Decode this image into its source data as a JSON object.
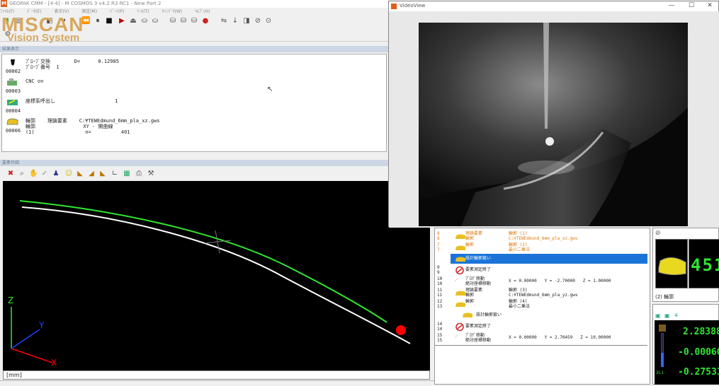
{
  "app": {
    "icon_letter": "M",
    "title": "GEOPAK CMM - [4-4] - M COSMOS 3 v4.2 R3 RC1 - New Part 2",
    "menu": [
      "ﾌｧｲﾙ(F)",
      "ﾃﾞｰﾀ(E)",
      "表示(V)",
      "測定(M)",
      "ﾊﾟｰﾄ(P)",
      "ﾂｰﾙ(T)",
      "ｳｨﾝﾄﾞｳ(W)",
      "ﾍﾙﾌﾟ(H)"
    ],
    "logo_line1": "MISCAN",
    "logo_line2": "Vision System",
    "accent": "#e35d1a"
  },
  "results": {
    "header": "結果表示",
    "rows": [
      {
        "num": "00002",
        "icon": "probe-icon",
        "text": "ﾌﾟﾛｰﾌﾞ交換        D=      0.12985\nﾌﾟﾛｰﾌﾞ番号  1"
      },
      {
        "num": "00003",
        "icon": "cnc-icon",
        "text": "CNC on"
      },
      {
        "num": "00004",
        "icon": "coordinate-icon",
        "text": "座標系呼出し                    1"
      },
      {
        "num": "00006",
        "icon": "contour-icon",
        "text": "輪郭    理論要素    C:¥TEWEdmund_6mm_pla_xz.gws\n輪郭                XY - 開曲線\n(1)                 n=          401"
      }
    ]
  },
  "graphics": {
    "header": "要素作図",
    "units_label": "[mm]",
    "axis_z": "Z",
    "axis_y": "Y",
    "axis_x": "X",
    "tools": [
      "delete-icon",
      "zoom-icon",
      "pan-icon",
      "check-icon",
      "probe-view-icon",
      "smile-icon",
      "plane-xz-icon",
      "plane-yz-icon",
      "plane-xy-icon",
      "axes-icon",
      "model-icon",
      "print-icon",
      "settings-icon"
    ]
  },
  "videoview": {
    "title": "VideoView",
    "minimize": "—",
    "maximize": "☐",
    "close": "✕"
  },
  "part_program": {
    "rows": [
      {
        "n1": "8",
        "n2": "8",
        "icon": "contour-icon",
        "t1": "理論要素",
        "t2": "輪郭 (1)",
        "t3": "輪郭",
        "t4": "C:¥TEWEdmund_6mm_pla_xz.gws",
        "orange": true
      },
      {
        "n1": "7",
        "n2": "7",
        "icon": "contour-icon",
        "t1": "輪郭",
        "t2": "輪郭 (2)",
        "t3": "",
        "t4": "最小二乗法",
        "orange": true
      },
      {
        "n1": "",
        "n2": "",
        "icon": "design-contour-icon",
        "t1": "設計輪郭扱い",
        "t2": "",
        "t3": "",
        "t4": "",
        "selected": true
      },
      {
        "n1": "9",
        "n2": "9",
        "icon": "stop-icon",
        "t1": "要素測定終了",
        "t2": "",
        "t3": "",
        "t4": ""
      },
      {
        "n1": "10",
        "n2": "10",
        "icon": "move-icon",
        "t1": "ﾌﾟﾛｸﾞ移動",
        "t2": "X = 0.00000   Y = -2.70000   Z = 1.00000",
        "t3": "絶対座標移動",
        "t4": ""
      },
      {
        "n1": "11",
        "n2": "11",
        "icon": "contour-icon",
        "t1": "理論要素",
        "t2": "輪郭 (3)",
        "t3": "輪郭",
        "t4": "C:¥TEWEdmund_6mm_pla_yz.gws"
      },
      {
        "n1": "12",
        "n2": "13",
        "icon": "contour-icon",
        "t1": "輪郭",
        "t2": "輪郭 (4)",
        "t3": "",
        "t4": "最小二乗法"
      },
      {
        "n1": "",
        "n2": "",
        "icon": "design-contour-icon",
        "t1": "設計輪郭扱い",
        "t2": "",
        "t3": "",
        "t4": ""
      },
      {
        "n1": "14",
        "n2": "14",
        "icon": "stop-icon",
        "t1": "要素測定終了",
        "t2": "",
        "t3": "",
        "t4": ""
      },
      {
        "n1": "15",
        "n2": "15",
        "icon": "move-icon",
        "t1": "ﾌﾟﾛｸﾞ移動",
        "t2": "X = 0.00000   Y = 2.70459   Z = 10.00000",
        "t3": "絶対座標移動",
        "t4": ""
      }
    ]
  },
  "element_panel": {
    "lcd_digits": "451",
    "label": "(2) 輪郭"
  },
  "position_panel": {
    "x": "2.28388",
    "y": "-0.00060",
    "z": "-0.27531",
    "gauge_label": "2L1"
  }
}
